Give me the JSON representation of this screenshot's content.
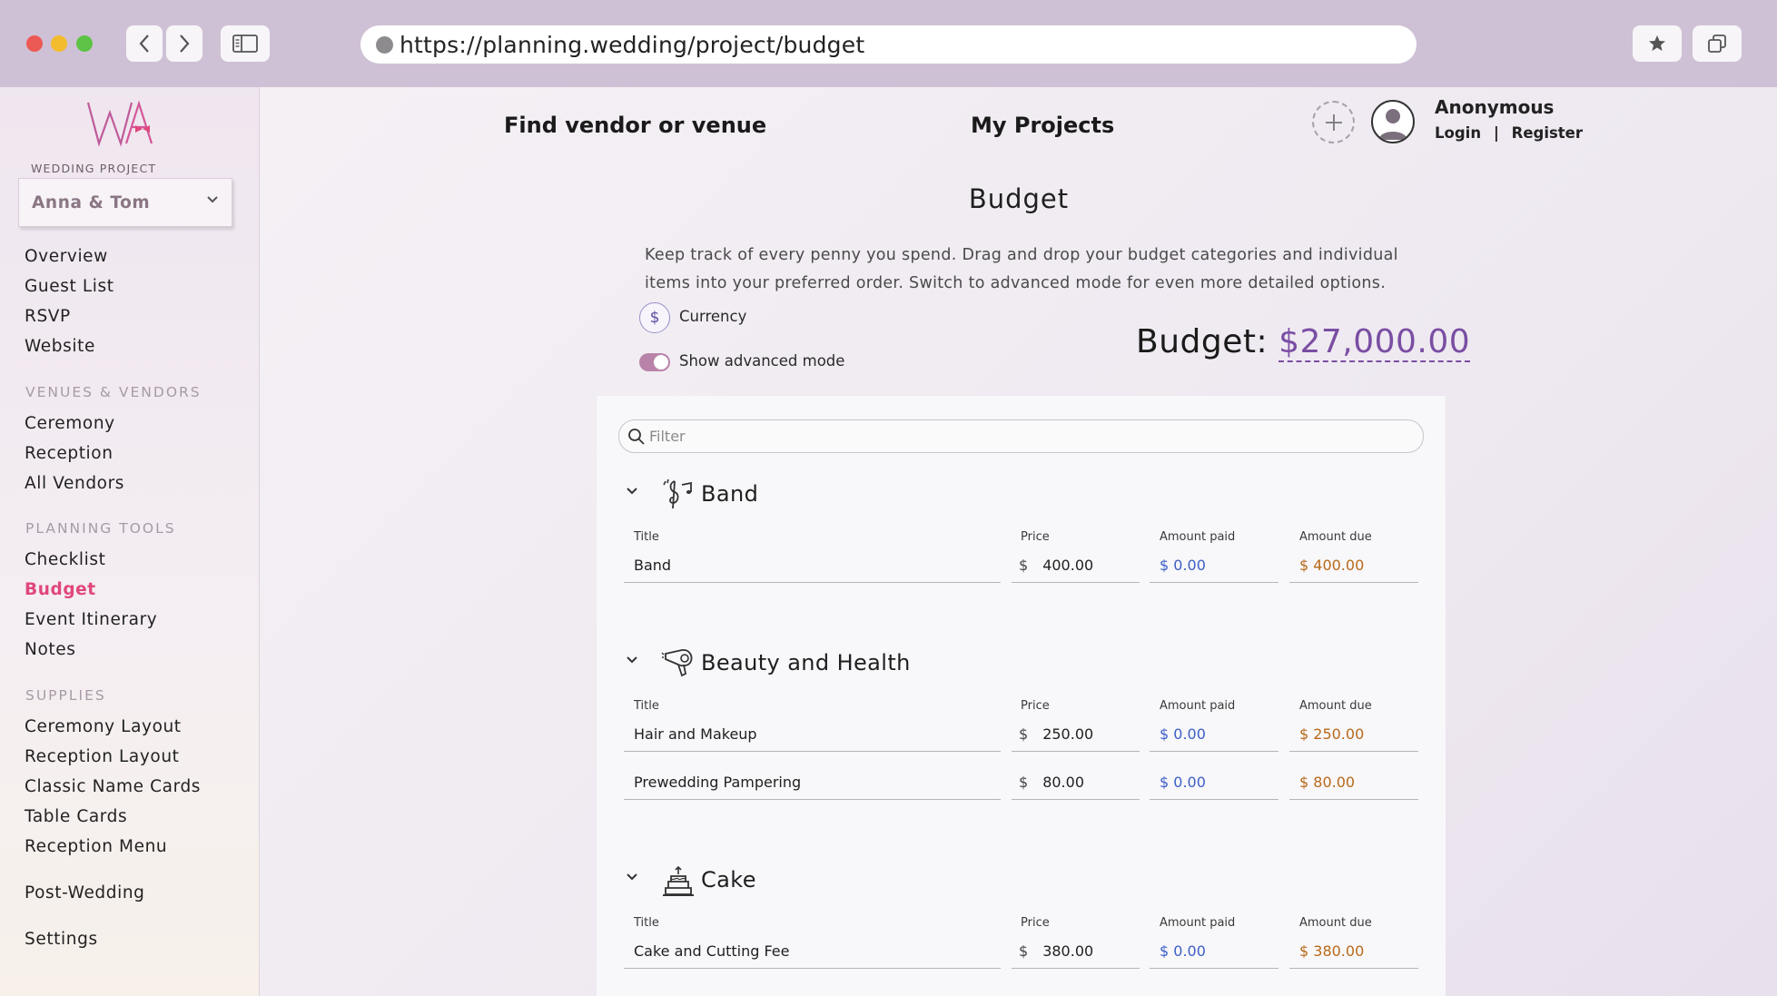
{
  "browser": {
    "url": "https://planning.wedding/project/budget"
  },
  "sidebar": {
    "project_label": "WEDDING PROJECT",
    "project_name": "Anna & Tom",
    "main_items": [
      "Overview",
      "Guest List",
      "RSVP",
      "Website"
    ],
    "venues_heading": "VENUES & VENDORS",
    "venues_items": [
      "Ceremony",
      "Reception",
      "All Vendors"
    ],
    "planning_heading": "PLANNING TOOLS",
    "planning_items": [
      "Checklist",
      "Budget",
      "Event Itinerary",
      "Notes"
    ],
    "supplies_heading": "SUPPLIES",
    "supplies_items": [
      "Ceremony Layout",
      "Reception Layout",
      "Classic Name Cards",
      "Table Cards",
      "Reception Menu"
    ],
    "post_wedding": "Post-Wedding",
    "settings": "Settings",
    "active_item": "Budget"
  },
  "header": {
    "find_vendor": "Find vendor or venue",
    "my_projects": "My Projects",
    "user_name": "Anonymous",
    "login": "Login",
    "separator": "|",
    "register": "Register"
  },
  "budget": {
    "title": "Budget",
    "description": "Keep track of every penny you spend. Drag and drop your budget categories and individual items into your preferred order. Switch to advanced mode for even more detailed options.",
    "currency_symbol": "$",
    "currency_label": "Currency",
    "advanced_mode_label": "Show advanced mode",
    "advanced_mode_on": true,
    "total_label": "Budget:",
    "total_amount": "$27,000.00",
    "filter_placeholder": "Filter",
    "columns": {
      "title": "Title",
      "price": "Price",
      "paid": "Amount paid",
      "due": "Amount due"
    },
    "categories": [
      {
        "name": "Band",
        "icon": "music-notes-icon",
        "items": [
          {
            "title": "Band",
            "price": "400.00",
            "paid": "$ 0.00",
            "due": "$ 400.00"
          }
        ]
      },
      {
        "name": "Beauty and Health",
        "icon": "hair-dryer-icon",
        "items": [
          {
            "title": "Hair and Makeup",
            "price": "250.00",
            "paid": "$ 0.00",
            "due": "$ 250.00"
          },
          {
            "title": "Prewedding Pampering",
            "price": "80.00",
            "paid": "$ 0.00",
            "due": "$ 80.00"
          }
        ]
      },
      {
        "name": "Cake",
        "icon": "cake-icon",
        "items": [
          {
            "title": "Cake and Cutting Fee",
            "price": "380.00",
            "paid": "$ 0.00",
            "due": "$ 380.00"
          }
        ]
      }
    ]
  },
  "colors": {
    "accent_pink": "#e0477b",
    "budget_purple": "#7a4ea3",
    "paid_blue": "#3c5fc8",
    "due_orange": "#b8691a"
  }
}
